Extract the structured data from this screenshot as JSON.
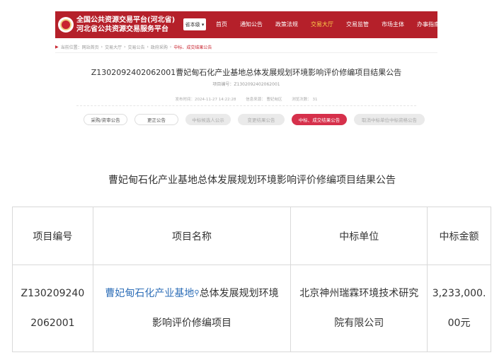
{
  "site": {
    "brand_line1": "全国公共资源交易平台(河北省)",
    "brand_line2": "河北省公共资源交易服务平台",
    "region_select": "省本级 ▾",
    "nav": [
      "首页",
      "通知公告",
      "政策法规",
      "交易大厅",
      "交易监管",
      "市场主体",
      "办事指南"
    ],
    "nav_active_index": 3,
    "colors": {
      "header": "#b5202a",
      "accent": "#d6304b",
      "active_nav": "#ffd24a"
    }
  },
  "breadcrumb": [
    "当前位置：",
    "网站首页",
    "交易大厅",
    "交易公告",
    "政府采购",
    "中标、成交结果公告"
  ],
  "doc": {
    "title": "Z1302092402062001曹妃甸石化产业基地总体发展规划环境影响评价修编项目结果公告",
    "project_no": "项目编号：Z1302092402062001",
    "publish_time": "发布时间：2024-11-27 14:22:28",
    "source": "信息来源：   曹妃甸区",
    "views": "浏览次数：  31"
  },
  "tabs": [
    {
      "label": "采购/资审公告",
      "state": "on"
    },
    {
      "label": "更正公告",
      "state": "on"
    },
    {
      "label": "中标候选人公示",
      "state": "off"
    },
    {
      "label": "变更结果公告",
      "state": "off"
    },
    {
      "label": "中标、成交结果公告",
      "state": "active"
    },
    {
      "label": "取消中标单位中标资格公告",
      "state": "off"
    }
  ],
  "article": {
    "title": "曹妃甸石化产业基地总体发展规划环境影响评价修编项目结果公告",
    "table": {
      "headers": [
        "项目编号",
        "项目名称",
        "中标单位",
        "中标金额"
      ],
      "row": {
        "project_no": "Z1302092402062001",
        "project_name_link": "曹妃甸石化产业基地",
        "project_name_rest": "总体发展规划环境影响评价修编项目",
        "winner": "北京神州瑞霖环境技术研究院有限公司",
        "amount": "3,233,000.00元"
      }
    }
  }
}
